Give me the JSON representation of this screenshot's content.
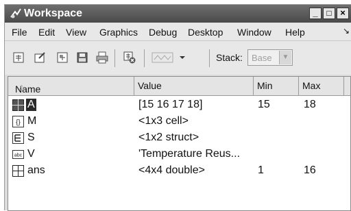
{
  "window": {
    "title": "Workspace",
    "controls": {
      "minimize": "_",
      "restore": "□",
      "close": "×"
    }
  },
  "menubar": {
    "items": [
      "File",
      "Edit",
      "View",
      "Graphics",
      "Debug",
      "Desktop",
      "Window",
      "Help"
    ],
    "more_arrow": "↘"
  },
  "toolbar": {
    "buttons": [
      "new-variable-icon",
      "open-variable-icon",
      "import-data-icon",
      "save-workspace-icon",
      "print-icon",
      "delete-variable-icon",
      "plot-selector-icon",
      "dropdown-arrow-icon"
    ],
    "stack_label": "Stack:",
    "stack_value": "Base",
    "stack_arrow": "▼"
  },
  "table": {
    "columns": [
      {
        "label": "Name",
        "sort": "△"
      },
      {
        "label": "Value"
      },
      {
        "label": "Min"
      },
      {
        "label": "Max"
      }
    ],
    "rows": [
      {
        "icon": "matrix-icon",
        "name": "A",
        "value": "[15 16 17 18]",
        "min": "15",
        "max": "18",
        "selected": true
      },
      {
        "icon": "cell-array-icon",
        "name": "M",
        "value": "<1x3 cell>",
        "min": "",
        "max": ""
      },
      {
        "icon": "struct-icon",
        "name": "S",
        "value": "<1x2 struct>",
        "min": "",
        "max": ""
      },
      {
        "icon": "char-array-icon",
        "name": "V",
        "value": "'Temperature Reus...",
        "min": "",
        "max": ""
      },
      {
        "icon": "matrix-icon",
        "name": "ans",
        "value": "<4x4 double>",
        "min": "1",
        "max": "16"
      }
    ]
  },
  "colors": {
    "titlebar": "#555555",
    "selection": "#2a2a2a"
  }
}
